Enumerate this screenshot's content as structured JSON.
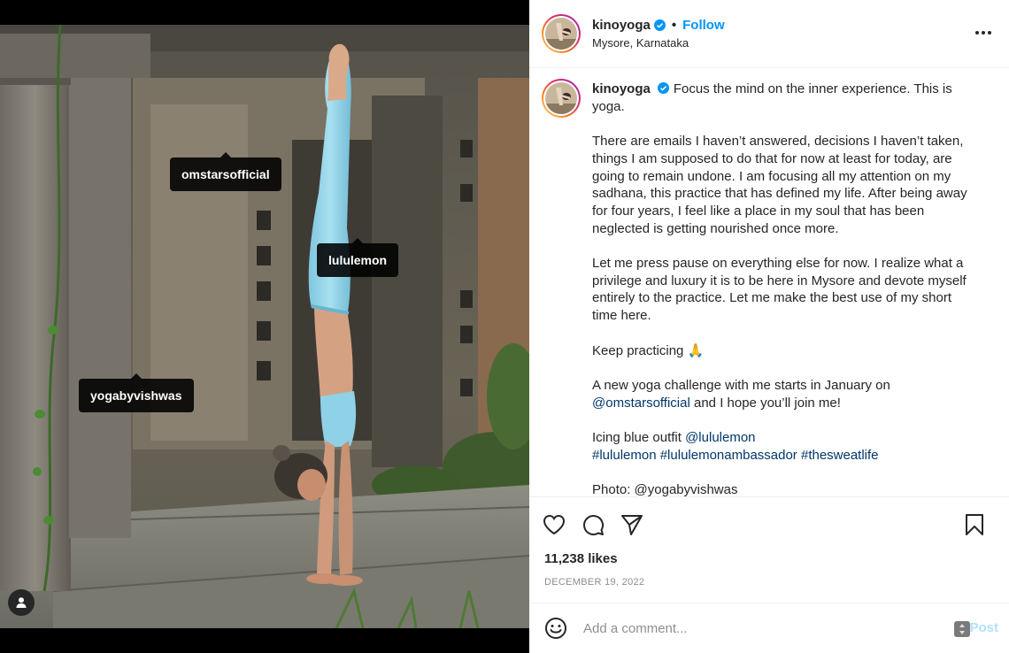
{
  "media": {
    "tags": [
      "omstarsofficial",
      "lululemon",
      "yogabyvishwas"
    ]
  },
  "header": {
    "username": "kinoyoga",
    "separator": "•",
    "follow_label": "Follow",
    "location": "Mysore, Karnataka"
  },
  "caption": {
    "username": "kinoyoga",
    "intro": "Focus the mind on the inner experience. This is yoga.",
    "p1": "There are emails I haven’t answered, decisions I haven’t taken, things I am supposed to do that for now at least for today, are going to remain undone. I am focusing all my attention on my sadhana, this practice that has defined my life. After being away for four years, I feel like a place in my soul that has been neglected is getting nourished once more.",
    "p2": "Let me press pause on everything else for now. I realize what a privilege and luxury it is to be here in Mysore and devote myself entirely to the practice. Let me make the best use of my short time here.",
    "p3": "Keep practicing 🙏",
    "p4_a": "A new yoga challenge with me starts in January on",
    "p4_mention": "@omstarsofficial",
    "p4_b": "and I hope you’ll join me!",
    "p5_a": "Icing blue outfit",
    "p5_mention": "@lululemon",
    "p5_tags": "#lululemon #lululemonambassador #thesweatlife",
    "p6": "Photo: @yogabyvishwas"
  },
  "stats": {
    "likes": "11,238 likes",
    "date": "DECEMBER 19, 2022"
  },
  "comment": {
    "placeholder": "Add a comment...",
    "post_label": "Post"
  },
  "colors": {
    "accent": "#0095f6",
    "mention": "#00376b",
    "post_disabled": "#b2dffc"
  }
}
